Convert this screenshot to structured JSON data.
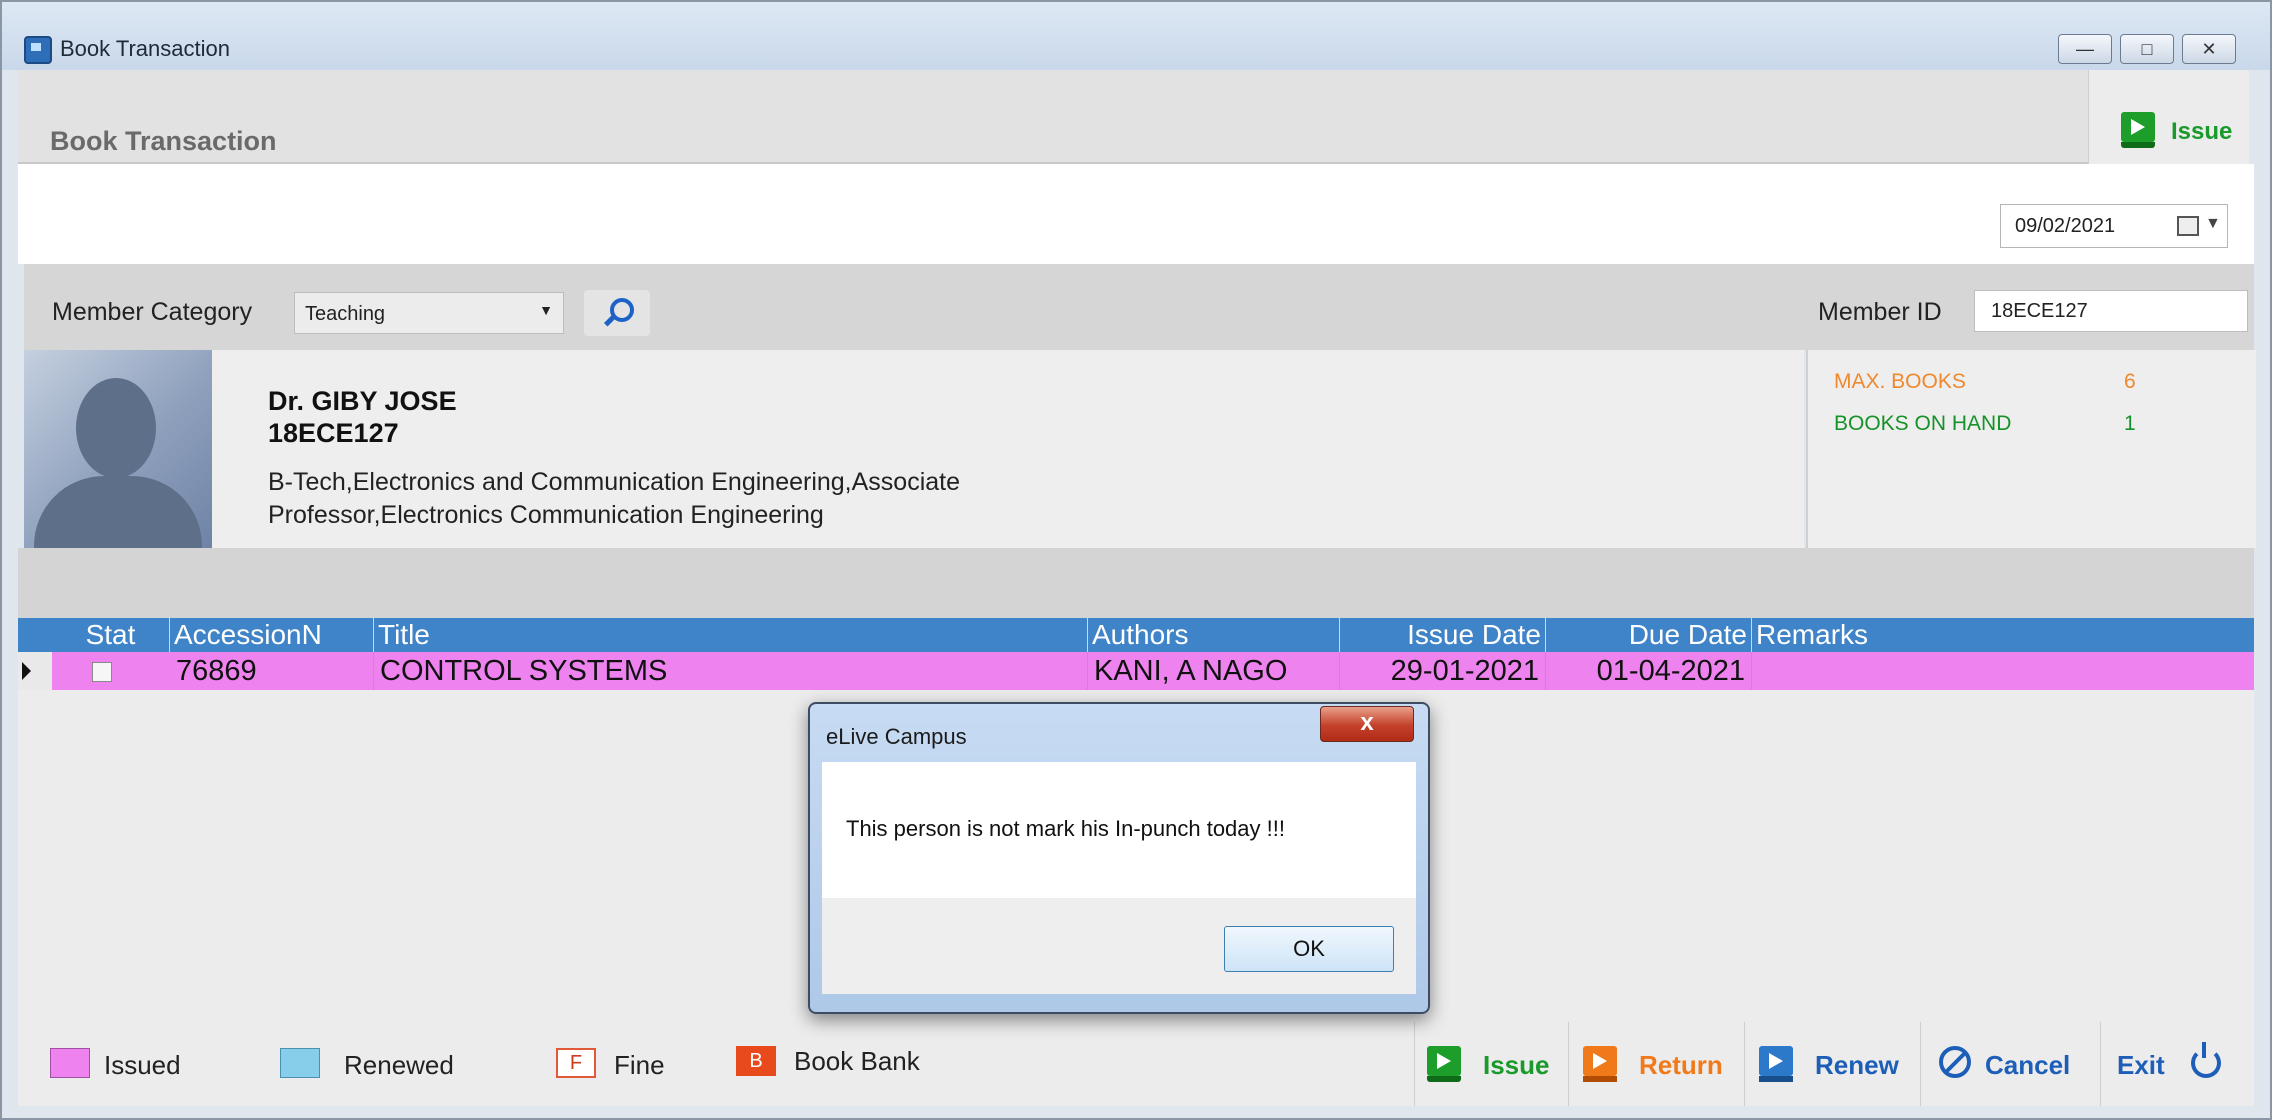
{
  "window": {
    "title": "Book Transaction",
    "controls": {
      "minimize": "—",
      "maximize": "□",
      "close": "✕"
    }
  },
  "panel": {
    "title": "Book Transaction",
    "top_action": "Issue"
  },
  "date": {
    "value": "09/02/2021"
  },
  "member": {
    "category_label": "Member Category",
    "category_value": "Teaching",
    "id_label": "Member ID",
    "id_value": "18ECE127"
  },
  "profile": {
    "name": "Dr. GIBY  JOSE",
    "id": "18ECE127",
    "description": "B-Tech,Electronics and Communication Engineering,Associate Professor,Electronics  Communication  Engineering"
  },
  "stats": {
    "max_books_label": "MAX. BOOKS",
    "max_books_value": "6",
    "books_on_hand_label": "BOOKS ON HAND",
    "books_on_hand_value": "1"
  },
  "grid": {
    "columns": [
      "Stat",
      "AccessionN",
      "Title",
      "Authors",
      "Issue Date",
      "Due Date",
      "Remarks"
    ],
    "rows": [
      {
        "accession": "76869",
        "title": "CONTROL SYSTEMS",
        "authors": "KANI, A NAGO",
        "issue_date": "29-01-2021",
        "due_date": "01-04-2021",
        "remarks": ""
      }
    ]
  },
  "legend": {
    "issued": "Issued",
    "renewed": "Renewed",
    "fine_mark": "F",
    "fine": "Fine",
    "bookbank_mark": "B",
    "bookbank": "Book Bank"
  },
  "actions": {
    "issue": "Issue",
    "return": "Return",
    "renew": "Renew",
    "cancel": "Cancel",
    "exit": "Exit"
  },
  "dialog": {
    "title": "eLive Campus",
    "close": "x",
    "message": "This person is not mark his In-punch today !!!",
    "ok": "OK"
  },
  "colors": {
    "issued": "#ee82ee",
    "renewed": "#87ceeb",
    "header": "#3f84c8",
    "green_action": "#1a9a2a",
    "orange_action": "#f07a1a",
    "blue_action": "#1d5fb8"
  }
}
